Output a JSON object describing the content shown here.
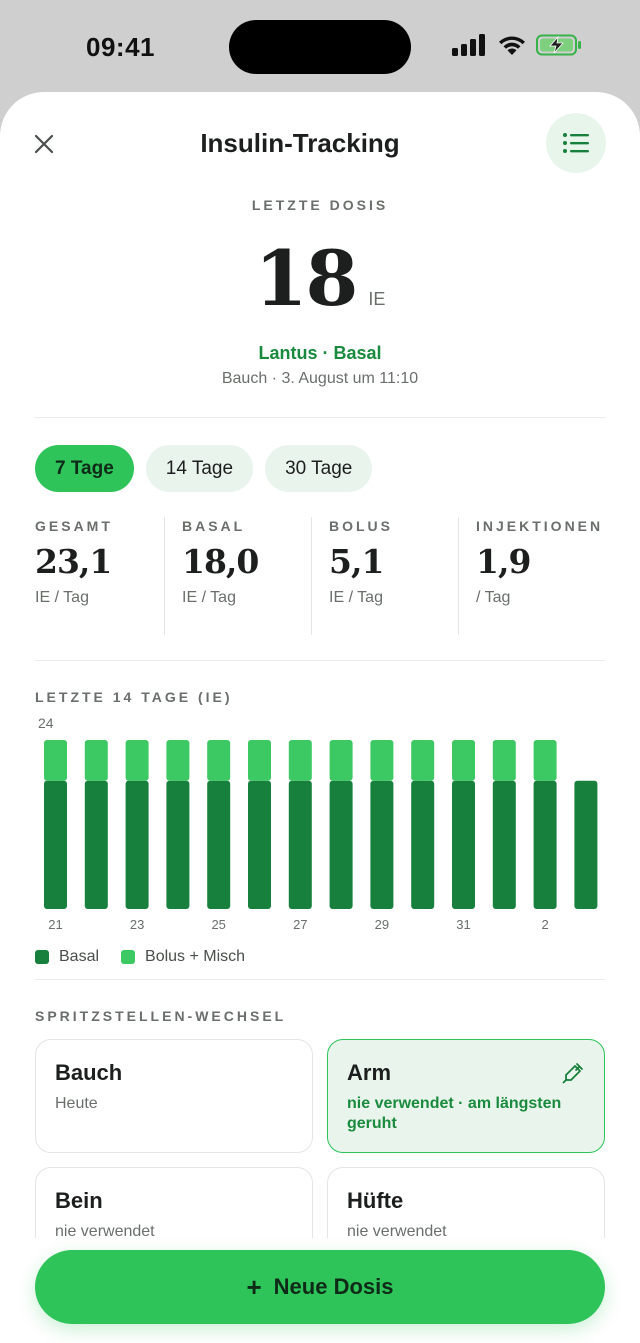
{
  "status_bar": {
    "time": "09:41"
  },
  "header": {
    "title": "Insulin-Tracking"
  },
  "last_dose": {
    "label": "LETZTE DOSIS",
    "value": "18",
    "unit": "IE",
    "medication": "Lantus · Basal",
    "details": "Bauch · 3. August um 11:10"
  },
  "range_chips": [
    {
      "label": "7 Tage",
      "active": true
    },
    {
      "label": "14 Tage",
      "active": false
    },
    {
      "label": "30 Tage",
      "active": false
    }
  ],
  "stats": [
    {
      "label": "GESAMT",
      "value": "23,1",
      "unit": "IE / Tag"
    },
    {
      "label": "BASAL",
      "value": "18,0",
      "unit": "IE / Tag"
    },
    {
      "label": "BOLUS",
      "value": "5,1",
      "unit": "IE / Tag"
    },
    {
      "label": "INJEKTIONEN",
      "value": "1,9",
      "unit": "/ Tag"
    }
  ],
  "chart_label": "LETZTE 14 TAGE (IE)",
  "chart_data": {
    "type": "bar",
    "stacked": true,
    "categories": [
      "21",
      "22",
      "23",
      "24",
      "25",
      "26",
      "27",
      "28",
      "29",
      "30",
      "31",
      "1",
      "2",
      "3"
    ],
    "tick_labels": [
      "21",
      "",
      "23",
      "",
      "25",
      "",
      "27",
      "",
      "29",
      "",
      "31",
      "",
      "2",
      ""
    ],
    "series": [
      {
        "name": "Basal",
        "color": "#17803d",
        "values": [
          18,
          18,
          18,
          18,
          18,
          18,
          18,
          18,
          18,
          18,
          18,
          18,
          18,
          18
        ]
      },
      {
        "name": "Bolus + Misch",
        "color": "#3cc963",
        "values": [
          6,
          6,
          6,
          6,
          6,
          6,
          6,
          6,
          6,
          6,
          6,
          6,
          6,
          0
        ]
      }
    ],
    "y_max_label": "24",
    "ylim": [
      0,
      24
    ]
  },
  "legend": [
    {
      "label": "Basal",
      "color": "#17803d"
    },
    {
      "label": "Bolus + Misch",
      "color": "#3cc963"
    }
  ],
  "sites": {
    "label": "SPRITZSTELLEN-WECHSEL",
    "items": [
      {
        "name": "Bauch",
        "sub": "Heute"
      },
      {
        "name": "Arm",
        "sub": "nie verwendet · am längsten geruht"
      },
      {
        "name": "Bein",
        "sub": "nie verwendet"
      },
      {
        "name": "Hüfte",
        "sub": "nie verwendet"
      }
    ]
  },
  "fab": {
    "plus": "+",
    "label": "Neue Dosis"
  }
}
